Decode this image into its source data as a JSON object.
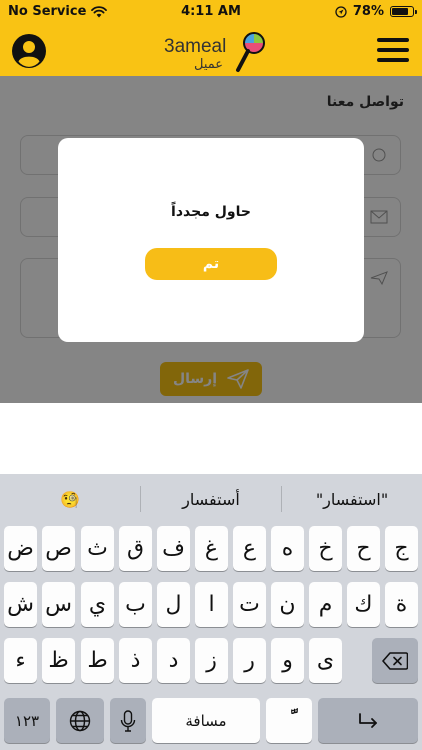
{
  "status_bar": {
    "carrier": "No Service",
    "time": "4:11 AM",
    "battery_percent": "78%",
    "battery_level": 0.78
  },
  "nav": {
    "logo_text_latin": "3ameal",
    "logo_text_arabic": "عميل"
  },
  "page": {
    "title": "تواصل معنا",
    "send_label": "إرسال"
  },
  "dialog": {
    "message": "حاول مجدداً",
    "ok_label": "تم"
  },
  "keyboard": {
    "suggestions": [
      "\"استفسار\"",
      "أستفسار",
      "🧐"
    ],
    "row1": [
      "ض",
      "ص",
      "ث",
      "ق",
      "ف",
      "غ",
      "ع",
      "ه",
      "خ",
      "ح",
      "ج"
    ],
    "row2": [
      "ش",
      "س",
      "ي",
      "ب",
      "ل",
      "ا",
      "ت",
      "ن",
      "م",
      "ك",
      "ة"
    ],
    "row3": [
      "ء",
      "ظ",
      "ط",
      "ذ",
      "د",
      "ز",
      "ر",
      "و",
      "ى"
    ],
    "numbers_label": "١٢٣",
    "space_label": "مسافة",
    "diacritic_label": "ًّ"
  },
  "colors": {
    "brand_yellow": "#f9c314",
    "overlay": "rgba(0,0,0,0.48)"
  },
  "icons": {
    "avatar": "user-circle-icon",
    "menu": "hamburger-icon",
    "wifi": "wifi-icon",
    "location": "location-arrow-icon",
    "battery": "battery-icon",
    "send": "paper-plane-icon",
    "globe": "globe-icon",
    "mic": "microphone-icon",
    "delete": "backspace-icon",
    "return": "return-icon"
  }
}
